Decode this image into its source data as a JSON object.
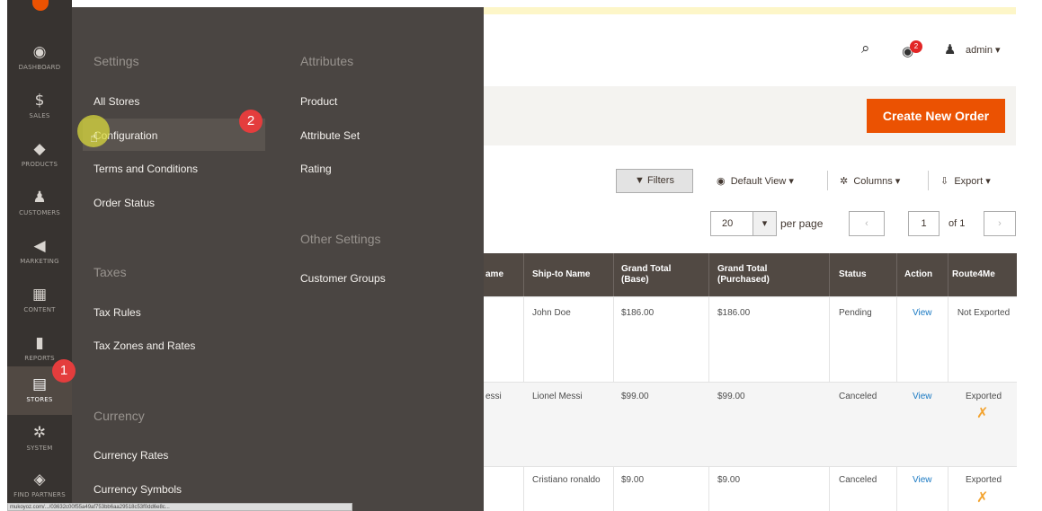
{
  "sidebar": {
    "items": [
      {
        "label": "DASHBOARD",
        "icon": "dashboard-icon",
        "glyph": "◉"
      },
      {
        "label": "SALES",
        "icon": "dollar-icon",
        "glyph": "$"
      },
      {
        "label": "PRODUCTS",
        "icon": "cube-icon",
        "glyph": "◆"
      },
      {
        "label": "CUSTOMERS",
        "icon": "person-icon",
        "glyph": "♟"
      },
      {
        "label": "MARKETING",
        "icon": "megaphone-icon",
        "glyph": "◀"
      },
      {
        "label": "CONTENT",
        "icon": "layout-icon",
        "glyph": "▦"
      },
      {
        "label": "REPORTS",
        "icon": "bar-chart-icon",
        "glyph": "▮"
      },
      {
        "label": "STORES",
        "icon": "storefront-icon",
        "glyph": "▤"
      },
      {
        "label": "SYSTEM",
        "icon": "gear-icon",
        "glyph": "✲"
      },
      {
        "label": "FIND PARTNERS",
        "icon": "box-icon",
        "glyph": "◈"
      }
    ]
  },
  "flyout": {
    "settings_title": "Settings",
    "settings": [
      "All Stores",
      "Configuration",
      "Terms and Conditions",
      "Order Status"
    ],
    "taxes_title": "Taxes",
    "taxes": [
      "Tax Rules",
      "Tax Zones and Rates"
    ],
    "currency_title": "Currency",
    "currency": [
      "Currency Rates",
      "Currency Symbols"
    ],
    "attributes_title": "Attributes",
    "attributes": [
      "Product",
      "Attribute Set",
      "Rating"
    ],
    "other_title": "Other Settings",
    "other": [
      "Customer Groups"
    ]
  },
  "annotations": {
    "step1": "1",
    "step2": "2"
  },
  "header": {
    "admin_label": "admin",
    "notifications_count": "2"
  },
  "actions": {
    "create_order": "Create New Order"
  },
  "toolbar": {
    "filters": "Filters",
    "default_view": "Default View",
    "columns": "Columns",
    "export": "Export",
    "page_size": "20",
    "per_page": "per page",
    "page": "1",
    "of_pages": "of 1"
  },
  "grid": {
    "columns": [
      "ame",
      "Ship-to Name",
      "Grand Total (Base)",
      "Grand Total (Purchased)",
      "Status",
      "Action",
      "Route4Me"
    ],
    "rows": [
      {
        "partial": "",
        "ship_to": "John Doe",
        "base": "$186.00",
        "purchased": "$186.00",
        "status": "Pending",
        "action": "View",
        "route": "Not Exported"
      },
      {
        "partial": "essi",
        "ship_to": "Lionel Messi",
        "base": "$99.00",
        "purchased": "$99.00",
        "status": "Canceled",
        "action": "View",
        "route": "Exported"
      },
      {
        "partial": "",
        "ship_to": "Cristiano ronaldo",
        "base": "$9.00",
        "purchased": "$9.00",
        "status": "Canceled",
        "action": "View",
        "route": "Exported"
      }
    ]
  },
  "statusbar": {
    "url": "mukoyoz.com/.../03632c00f55a49af753bb6aa29518c53f0dd6e8c..."
  },
  "colors": {
    "accent": "#eb5202",
    "sidebar": "#373330",
    "flyout": "#4a4542",
    "grid_header": "#514943",
    "link": "#1979c3"
  }
}
